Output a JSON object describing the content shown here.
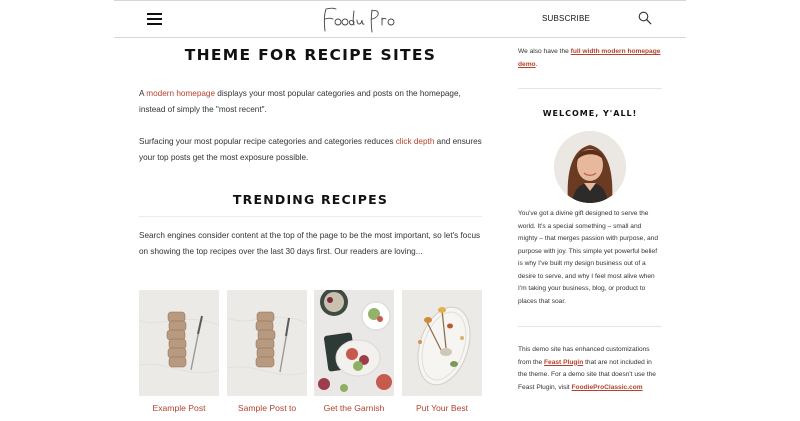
{
  "header": {
    "logo_text": "Foodie Pro",
    "subscribe_label": "SUBSCRIBE"
  },
  "main": {
    "title": "THEME FOR RECIPE SITES",
    "para1": {
      "prefix": "A ",
      "link": "modern homepage",
      "suffix": " displays your most popular categories and posts on the homepage, instead of simply the \"most recent\"."
    },
    "para2": {
      "prefix": "Surfacing your most popular recipe categories and categories reduces ",
      "link": "click depth",
      "suffix": " and ensures your top posts get the most exposure possible."
    },
    "section_title": "TRENDING RECIPES",
    "para3": "Search engines consider content at the top of the page to be the most important, so let's focus on showing the top recipes over the last 30 days first. Our readers are loving...",
    "cards": [
      {
        "title": "Example Post"
      },
      {
        "title": "Sample Post to"
      },
      {
        "title": "Get the Garnish"
      },
      {
        "title": "Put Your Best"
      }
    ]
  },
  "sidebar": {
    "intro_prefix": "We also have the ",
    "intro_link": "full width modern homepage demo",
    "intro_suffix": ".",
    "welcome_title": "WELCOME, Y'ALL!",
    "bio": "You've got a divine gift designed to serve the world. It's a special something – small and mighty – that merges passion with purpose, and purpose with joy. This simple yet powerful belief is why I've built my design business out of a desire to serve, and why I feel most alive when I'm taking your business, blog, or product to places that soar.",
    "demo_prefix": "This demo site has enhanced customizations from the ",
    "demo_link": "Feast Plugin",
    "demo_middle": " that are not included in the theme. For a demo site that doesn't use the Feast Plugin, visit ",
    "demo_link2": "FoodieProClassic.com"
  },
  "colors": {
    "accent": "#b5422d",
    "heading": "#111111",
    "text": "#333333"
  },
  "icons": {
    "menu": "hamburger-menu-icon",
    "search": "search-icon"
  }
}
